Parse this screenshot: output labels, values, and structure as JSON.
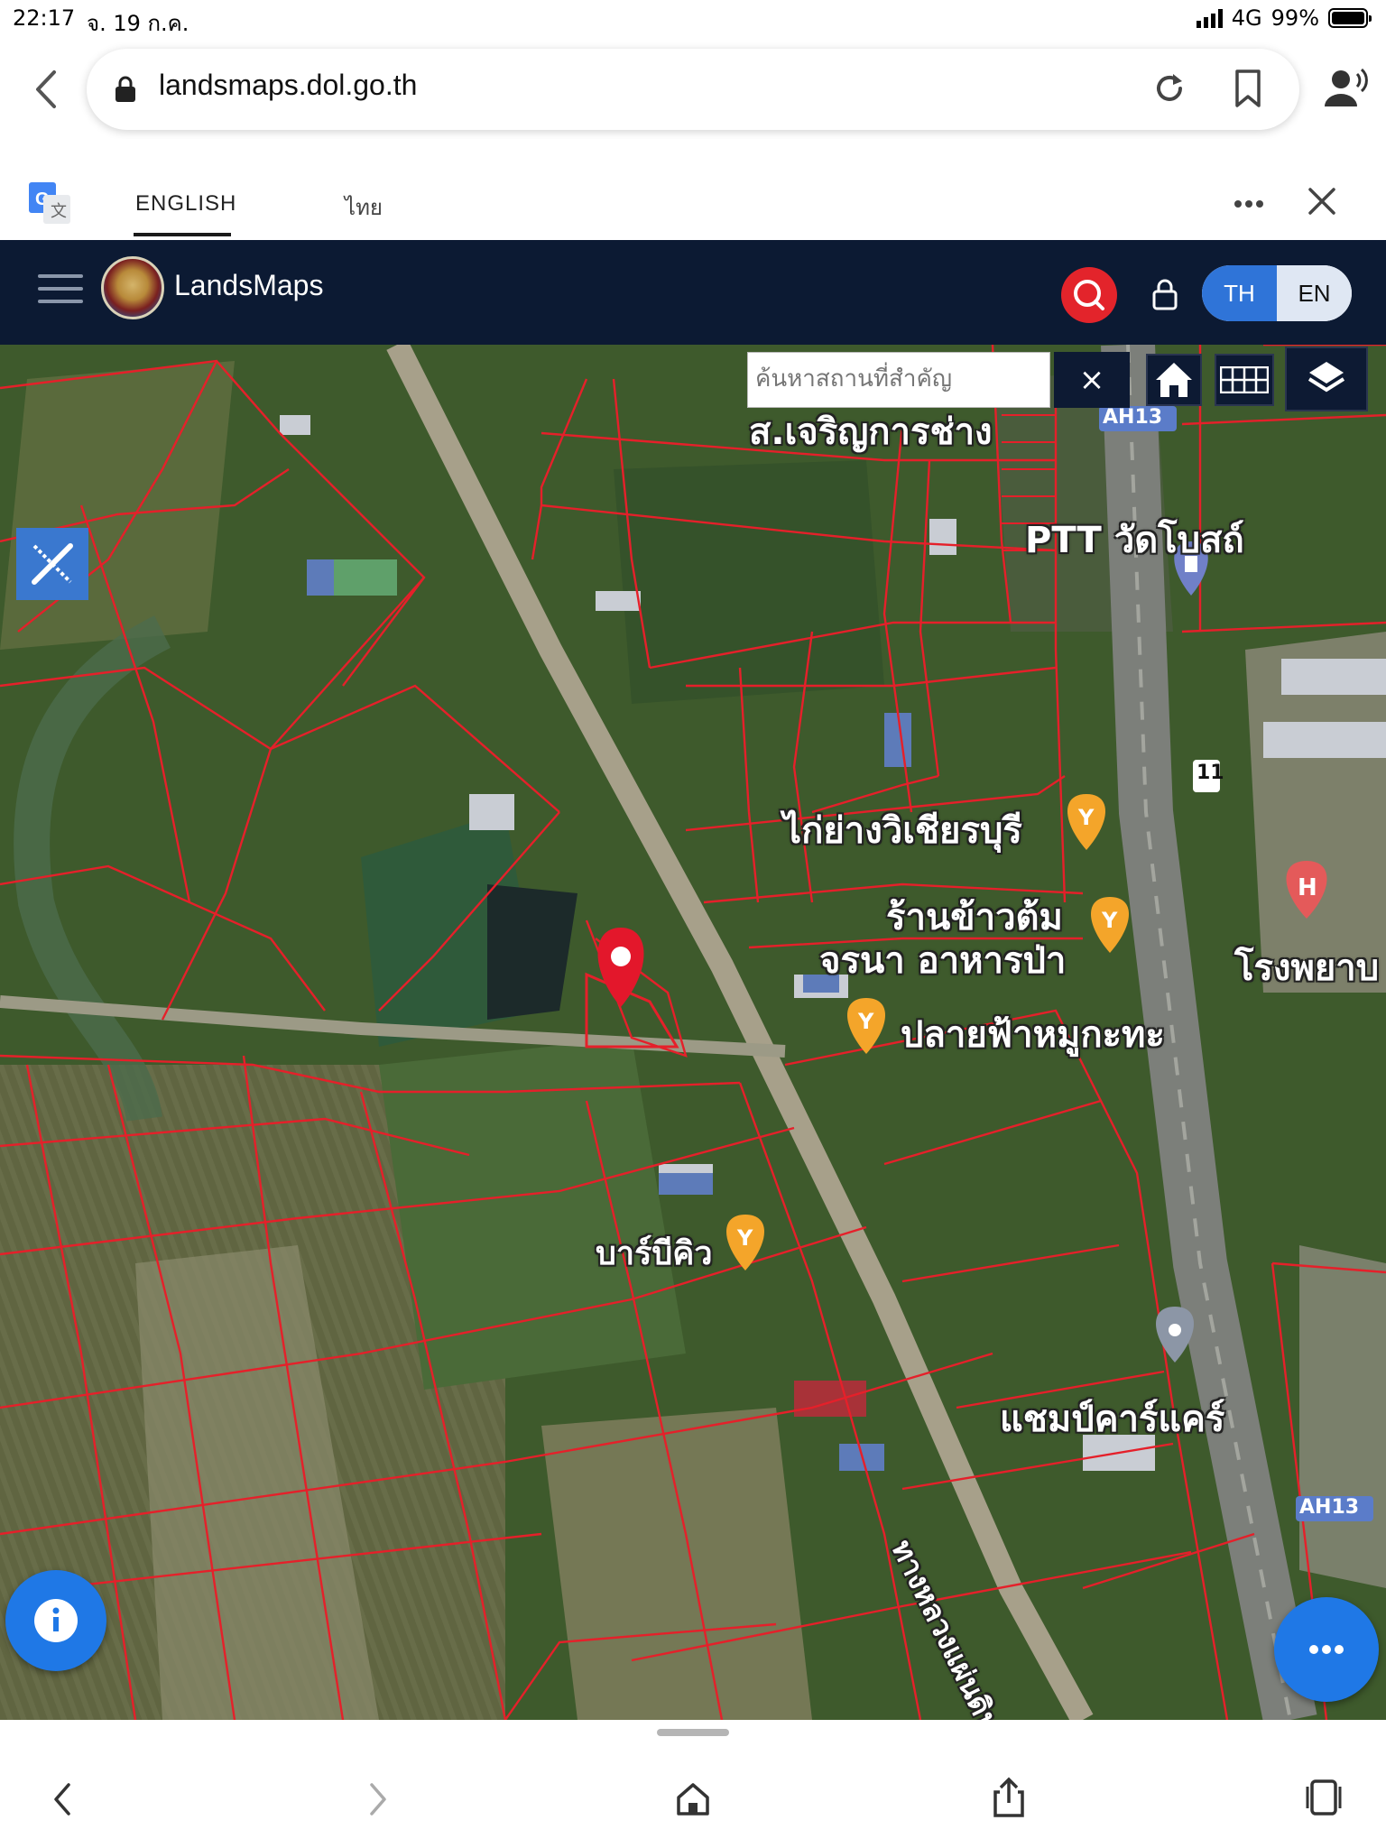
{
  "status": {
    "time": "22:17",
    "date": "จ. 19 ก.ค.",
    "network": "4G",
    "battery": "99%",
    "battery_level": 0.99
  },
  "browser": {
    "url": "landsmaps.dol.go.th"
  },
  "translate_bar": {
    "tab_english": "ENGLISH",
    "tab_thai": "ไทย"
  },
  "app": {
    "title": "LandsMaps",
    "lang_th": "TH",
    "lang_en": "EN",
    "lang_selected": "TH",
    "accent": "#2f74d8",
    "header_bg": "#0c1a33"
  },
  "map": {
    "search_placeholder": "ค้นหาสถานที่สำคัญ",
    "clear_label": "×",
    "parcel_line_color": "#e5202a",
    "labels": {
      "sorjarunkarnchang": "ส.เจริญการช่าง",
      "ptt": "PTT วัดโบสถ์",
      "ah13_top": "AH13",
      "ah13_bottom": "AH13",
      "route11": "11",
      "kaiyang": "ไก่ย่างวิเชียรบุรี",
      "rankhaotom": "ร้านข้าวต้ม",
      "jonna": "จรนา อาหารป่า",
      "plaifa": "ปลายฟ้าหมูกะทะ",
      "hospital": "โรงพยาบ",
      "barbecue": "บาร์บีคิว",
      "champcarcare": "แชมป์คาร์แคร์",
      "highway": "ทางหลวงแผ่นดินหมาย"
    }
  }
}
